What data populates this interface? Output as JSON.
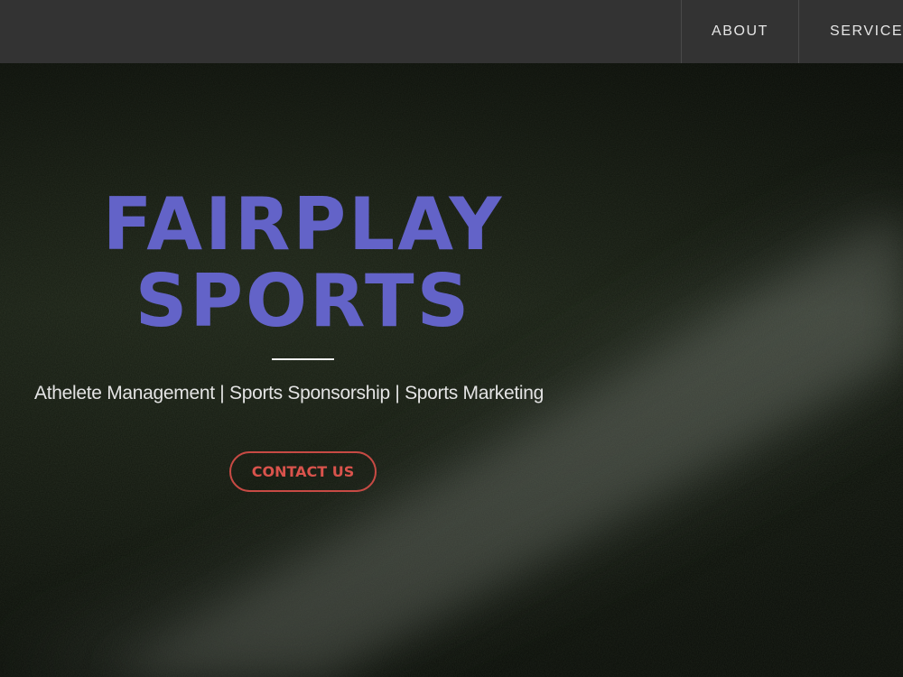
{
  "nav": {
    "items": [
      {
        "label": "ABOUT"
      },
      {
        "label": "SERVICES"
      }
    ]
  },
  "hero": {
    "title_line1": "FAIRPLAY",
    "title_line2": "SPORTS",
    "tagline": "Athelete Management | Sports Sponsorship | Sports Marketing",
    "cta_label": "CONTACT US"
  },
  "colors": {
    "title": "#6363c8",
    "cta": "#d9534c",
    "navbar": "#333333"
  }
}
